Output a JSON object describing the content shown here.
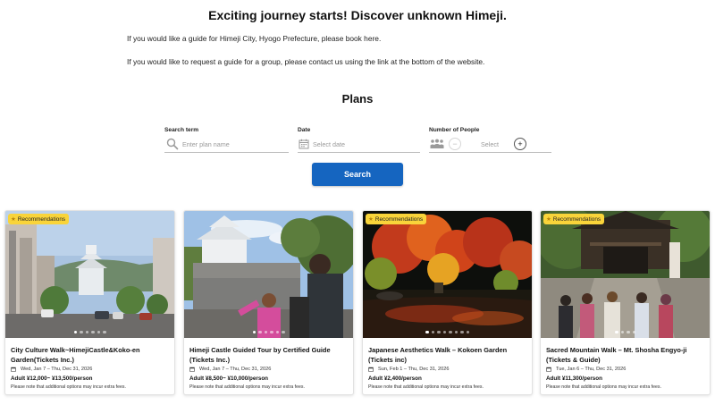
{
  "hero": {
    "title": "Exciting journey starts! Discover unknown Himeji.",
    "line1": "If you would like a guide for Himeji City, Hyogo Prefecture, please book here.",
    "line2": "If you would like to request a guide for a group, please contact us using the link at the bottom of the website."
  },
  "plans": {
    "title": "Plans",
    "search_term_label": "Search term",
    "search_term_placeholder": "Enter plan name",
    "date_label": "Date",
    "date_placeholder": "Select date",
    "people_label": "Number of People",
    "people_placeholder": "Select",
    "minus": "−",
    "plus": "+",
    "search_button": "Search"
  },
  "cards": [
    {
      "badge": "Recommendations",
      "title": "City Culture Walk~HimejiCastle&Koko-en Garden(Tickets Inc.)",
      "date": "Wed, Jan 7 – Thu, Dec 31, 2026",
      "price": "Adult ¥12,000~ ¥13,500/person",
      "note": "Please note that additional options may incur extra fees.",
      "image": "himeji-castle-street-view",
      "dots": 6,
      "active_dot": 0
    },
    {
      "badge": "",
      "title": "Himeji Castle Guided Tour by Certified Guide (Tickets Inc.)",
      "date": "Wed, Jan 7 – Thu, Dec 31, 2026",
      "price": "Adult ¥8,500~ ¥10,000/person",
      "note": "Please note that additional options may incur extra fees.",
      "image": "guide-with-tourists-at-castle",
      "dots": 6,
      "active_dot": 0
    },
    {
      "badge": "Recommendations",
      "title": "Japanese Aesthetics Walk – Kokoen Garden (Tickets inc)",
      "date": "Sun, Feb 1 – Thu, Dec 31, 2026",
      "price": "Adult ¥2,400/person",
      "note": "Please note that additional options may incur extra fees.",
      "image": "autumn-garden-night-illumination",
      "dots": 8,
      "active_dot": 0
    },
    {
      "badge": "Recommendations",
      "title": "Sacred Mountain Walk – Mt. Shosha Engyo-ji (Tickets & Guide)",
      "date": "Tue, Jan 6 – Thu, Dec 31, 2026",
      "price": "Adult ¥11,300/person",
      "note": "Please note that additional options may incur extra fees.",
      "image": "temple-gate-with-visitors",
      "dots": 4,
      "active_dot": 0
    }
  ],
  "colors": {
    "accent": "#1565c0",
    "badge": "#f9d43a"
  }
}
